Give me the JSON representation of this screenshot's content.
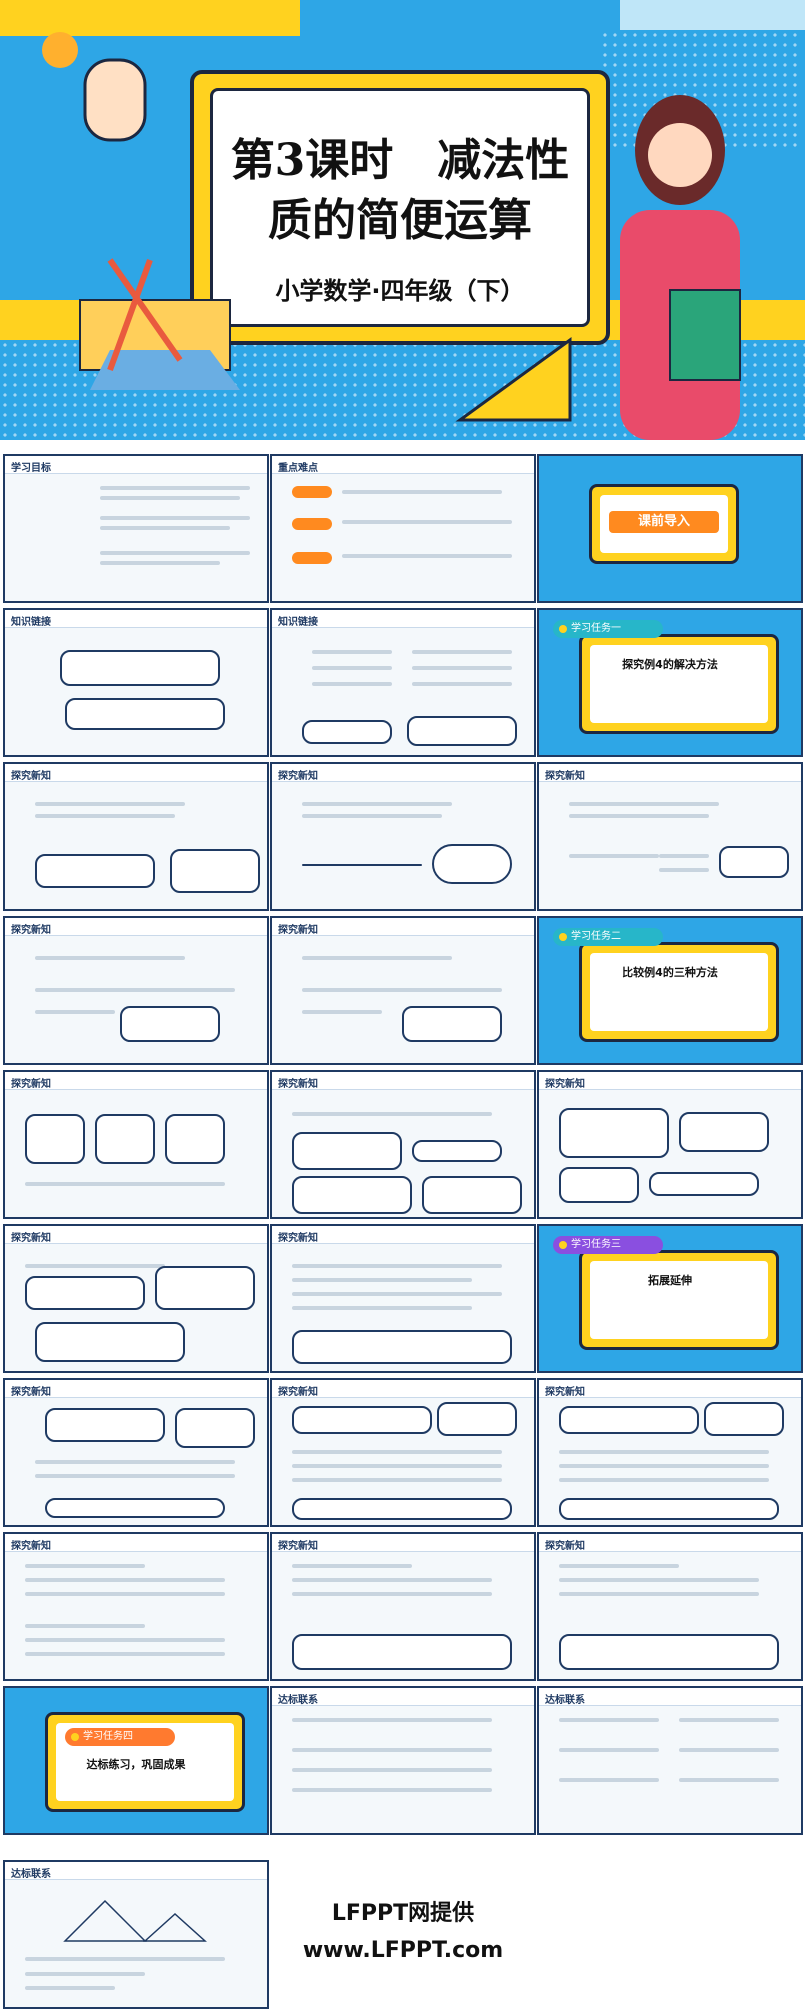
{
  "hero": {
    "title_line1": "第3课时　减法性",
    "title_line2": "质的简便运算",
    "subtitle": "小学数学·四年级（下）"
  },
  "slides": [
    {
      "header": "学习目标"
    },
    {
      "header": "重点难点"
    },
    {
      "header": "课前导入"
    },
    {
      "header": "知识链接"
    },
    {
      "header": "知识链接"
    },
    {
      "header": "学习任务一",
      "desc": "探究例4的解决方法"
    },
    {
      "header": "探究新知"
    },
    {
      "header": "探究新知"
    },
    {
      "header": "探究新知"
    },
    {
      "header": "探究新知"
    },
    {
      "header": "探究新知"
    },
    {
      "header": "学习任务二",
      "desc": "比较例4的三种方法"
    },
    {
      "header": "探究新知"
    },
    {
      "header": "探究新知"
    },
    {
      "header": "探究新知"
    },
    {
      "header": "探究新知"
    },
    {
      "header": "探究新知"
    },
    {
      "header": "学习任务三",
      "desc": "拓展延伸"
    },
    {
      "header": "探究新知"
    },
    {
      "header": "探究新知"
    },
    {
      "header": "探究新知"
    },
    {
      "header": "探究新知"
    },
    {
      "header": "探究新知"
    },
    {
      "header": "探究新知"
    },
    {
      "header": "学习任务四",
      "desc": "达标练习，巩固成果"
    },
    {
      "header": "达标联系"
    },
    {
      "header": "达标联系"
    },
    {
      "header": "达标联系"
    }
  ],
  "watermark": {
    "line1": "LFPPT网提供",
    "line2": "www.LFPPT.com"
  }
}
